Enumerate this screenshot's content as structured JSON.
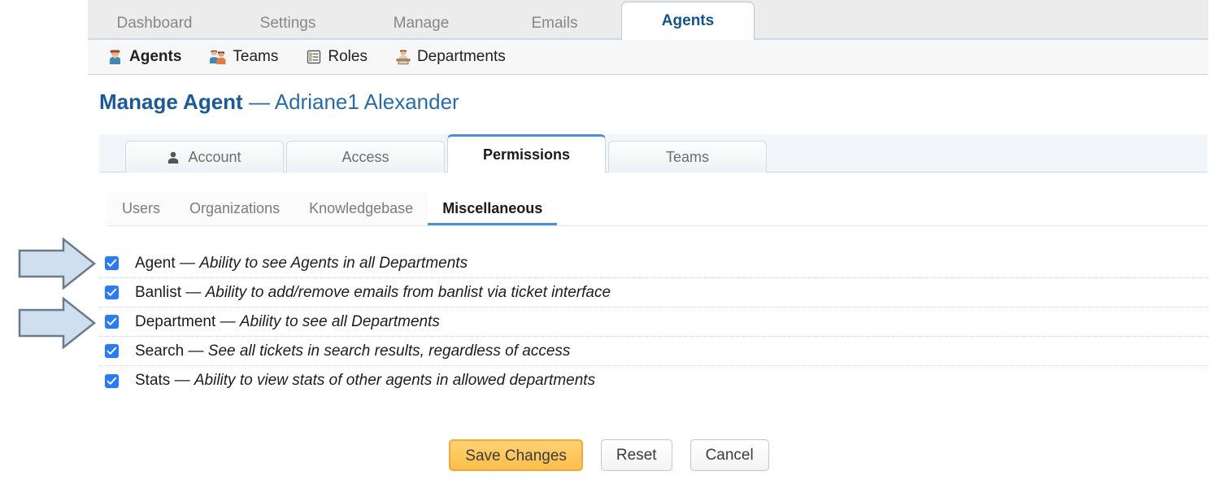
{
  "top_nav": {
    "tabs": [
      {
        "label": "Dashboard",
        "active": false
      },
      {
        "label": "Settings",
        "active": false
      },
      {
        "label": "Manage",
        "active": false
      },
      {
        "label": "Emails",
        "active": false
      },
      {
        "label": "Agents",
        "active": true
      }
    ]
  },
  "sub_nav": {
    "items": [
      {
        "label": "Agents",
        "icon": "agent-person-icon",
        "active": true
      },
      {
        "label": "Teams",
        "icon": "teams-people-icon",
        "active": false
      },
      {
        "label": "Roles",
        "icon": "roles-list-icon",
        "active": false
      },
      {
        "label": "Departments",
        "icon": "departments-desk-icon",
        "active": false
      }
    ]
  },
  "page": {
    "title": "Manage Agent",
    "separator": "—",
    "subject": "Adriane1 Alexander"
  },
  "main_tabs": [
    {
      "label": "Account",
      "icon": "user-silhouette-icon",
      "active": false
    },
    {
      "label": "Access",
      "icon": "",
      "active": false
    },
    {
      "label": "Permissions",
      "icon": "",
      "active": true
    },
    {
      "label": "Teams",
      "icon": "",
      "active": false
    }
  ],
  "sub_tabs": [
    {
      "label": "Users",
      "active": false
    },
    {
      "label": "Organizations",
      "active": false
    },
    {
      "label": "Knowledgebase",
      "active": false
    },
    {
      "label": "Miscellaneous",
      "active": true
    }
  ],
  "permissions": [
    {
      "name": "Agent",
      "dash": "—",
      "description": "Ability to see Agents in all Departments",
      "checked": true
    },
    {
      "name": "Banlist",
      "dash": "—",
      "description": "Ability to add/remove emails from banlist via ticket interface",
      "checked": true
    },
    {
      "name": "Department",
      "dash": "—",
      "description": "Ability to see all Departments",
      "checked": true
    },
    {
      "name": "Search",
      "dash": "—",
      "description": "See all tickets in search results, regardless of access",
      "checked": true
    },
    {
      "name": "Stats",
      "dash": "—",
      "description": "Ability to view stats of other agents in allowed departments",
      "checked": true
    }
  ],
  "footer": {
    "save_label": "Save Changes",
    "reset_label": "Reset",
    "cancel_label": "Cancel"
  },
  "annotations": [
    {
      "name": "arrow-pointing-agent-row",
      "target": "Agent"
    },
    {
      "name": "arrow-pointing-department-row",
      "target": "Department"
    }
  ],
  "colors": {
    "active_tab_text": "#14548c",
    "title": "#1b5a96",
    "accent_underline": "#4a90d9",
    "checkbox": "#2a7cf0",
    "primary_button": "#fbbf4a",
    "annotation_arrow_fill": "#cfdff0"
  }
}
